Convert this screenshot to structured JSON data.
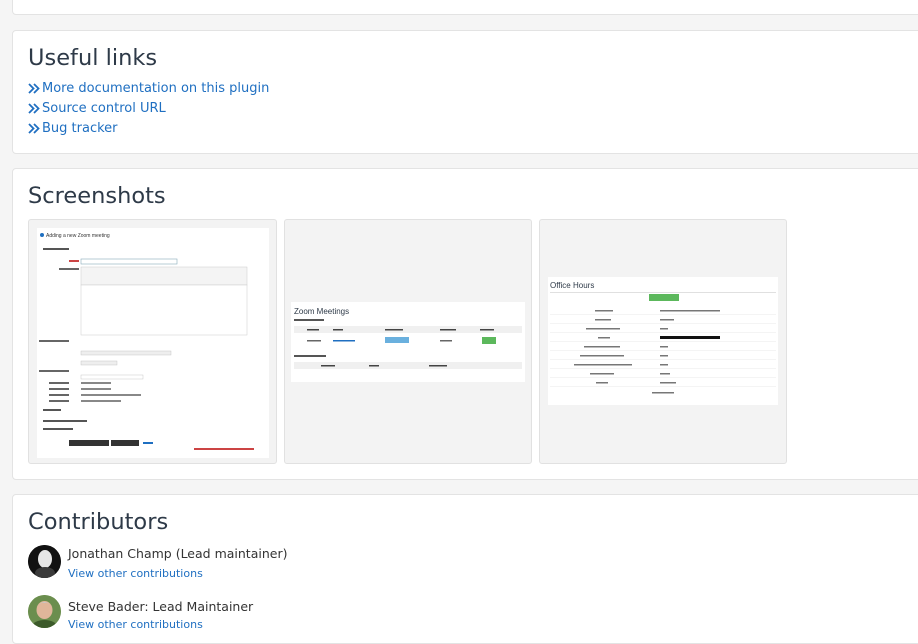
{
  "useful_links": {
    "title": "Useful links",
    "links": [
      {
        "label": "More documentation on this plugin"
      },
      {
        "label": "Source control URL"
      },
      {
        "label": "Bug tracker"
      }
    ]
  },
  "screenshots": {
    "title": "Screenshots",
    "items": [
      {
        "caption": "Adding a new Zoom meeting"
      },
      {
        "caption": "Zoom Meetings"
      },
      {
        "caption": "Office Hours"
      }
    ]
  },
  "contributors": {
    "title": "Contributors",
    "people": [
      {
        "name": "Jonathan Champ (Lead maintainer)",
        "link": "View other contributions"
      },
      {
        "name": "Steve Bader: Lead Maintainer",
        "link": "View other contributions"
      }
    ]
  },
  "colors": {
    "link": "#1f6fc1",
    "heading": "#2e3a48",
    "card_border": "#e3e3e3"
  }
}
